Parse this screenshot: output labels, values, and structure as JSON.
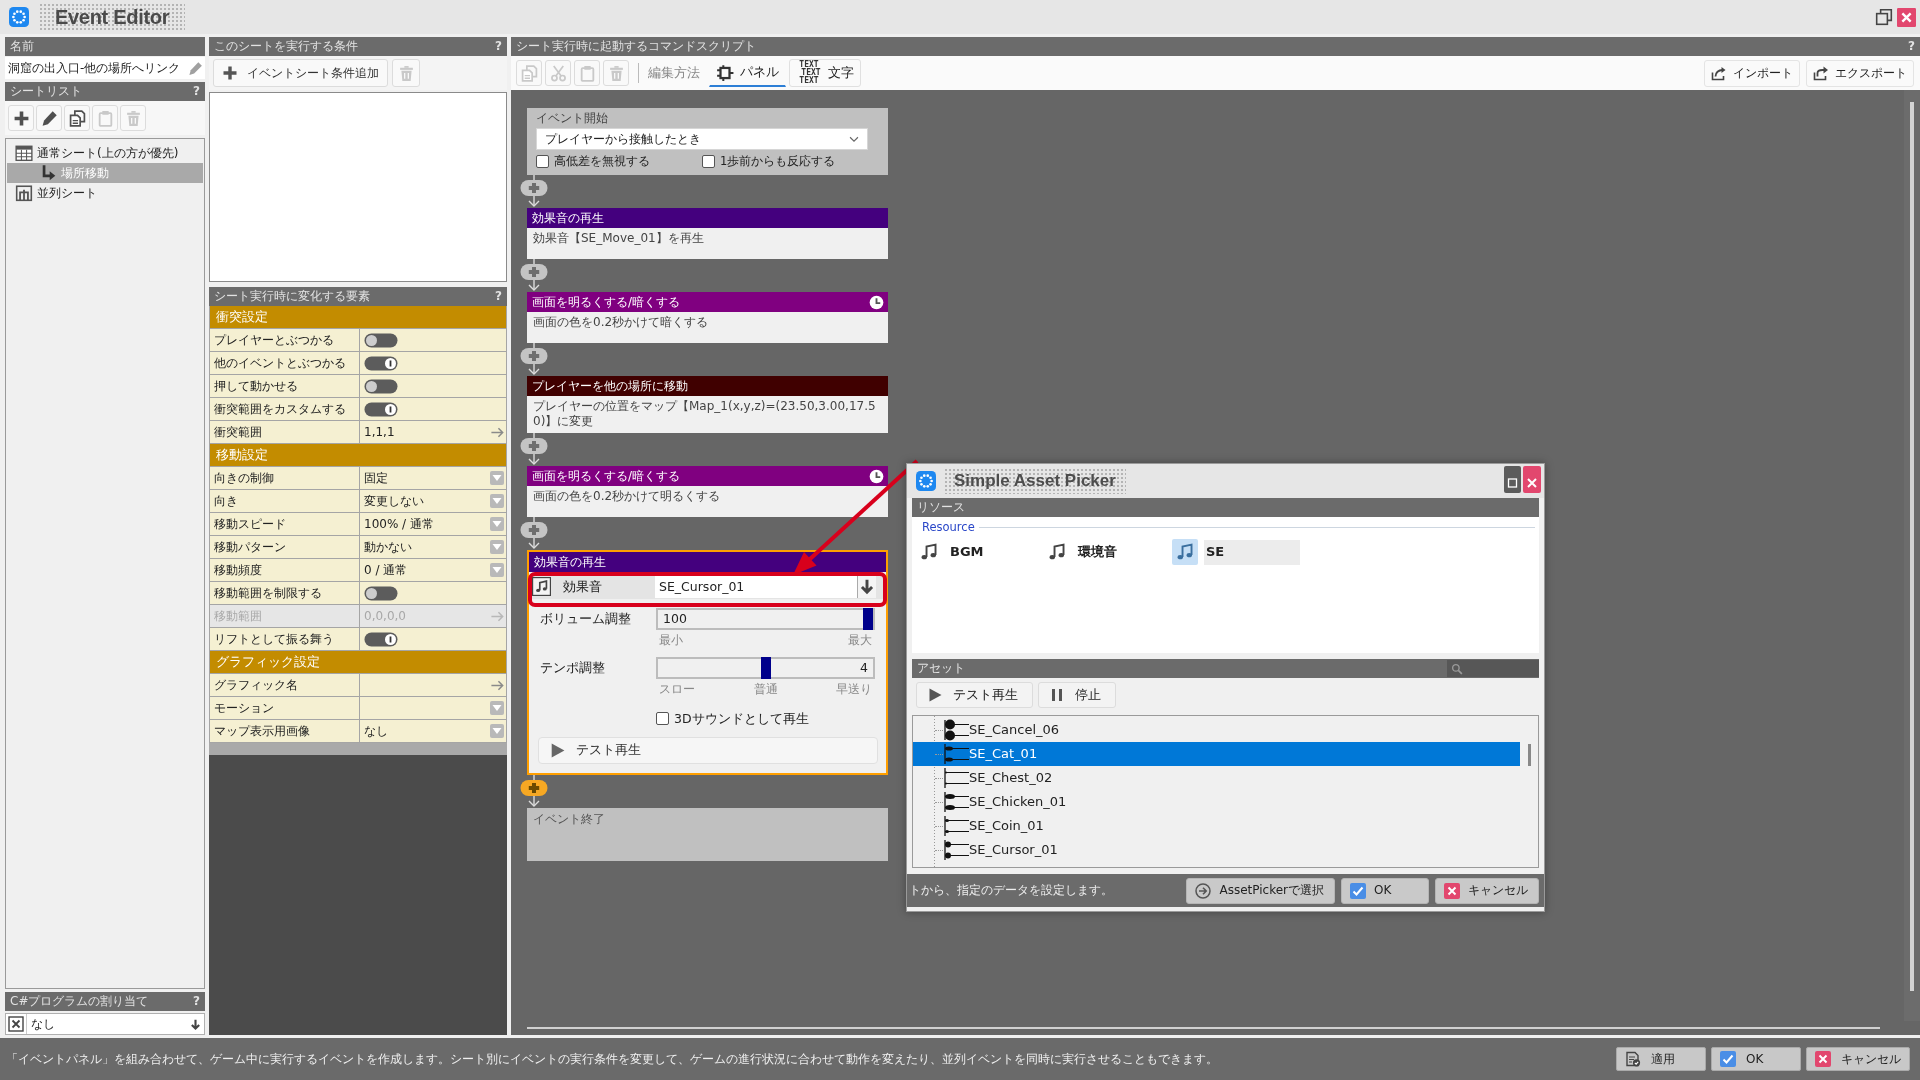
{
  "window": {
    "title": "Event Editor"
  },
  "name_panel": {
    "header": "名前",
    "value": "洞窟の出入口-他の場所へリンク"
  },
  "sheet_list": {
    "header": "シートリスト",
    "help": "?",
    "tools": [
      {
        "kind": "add",
        "disabled": false
      },
      {
        "kind": "edit",
        "disabled": false
      },
      {
        "kind": "copy",
        "disabled": false
      },
      {
        "kind": "paste",
        "disabled": true
      },
      {
        "kind": "delete",
        "disabled": true
      }
    ],
    "tree": [
      {
        "label": "通常シート(上の方が優先)",
        "kind": "normal",
        "selected": false,
        "children": [
          {
            "label": "場所移動",
            "kind": "item",
            "selected": true
          }
        ]
      },
      {
        "label": "並列シート",
        "kind": "parallel",
        "selected": false
      }
    ]
  },
  "csharp": {
    "header": "C#プログラムの割り当て",
    "help": "?",
    "value": "なし"
  },
  "conditions": {
    "header": "このシートを実行する条件",
    "help": "?",
    "add_button": "イベントシート条件追加",
    "delete_button": {
      "disabled": true
    }
  },
  "properties": {
    "header": "シート実行時に変化する要素",
    "help": "?",
    "groups": [
      {
        "title": "衝突設定",
        "rows": [
          {
            "label": "プレイヤーとぶつかる",
            "kind": "toggle",
            "on": false,
            "disabled": false
          },
          {
            "label": "他のイベントとぶつかる",
            "kind": "toggle",
            "on": true,
            "disabled": false
          },
          {
            "label": "押して動かせる",
            "kind": "toggle",
            "on": false,
            "disabled": false
          },
          {
            "label": "衝突範囲をカスタムする",
            "kind": "toggle",
            "on": true,
            "disabled": false
          },
          {
            "label": "衝突範囲",
            "kind": "link",
            "value": "1,1,1",
            "disabled": false
          }
        ]
      },
      {
        "title": "移動設定",
        "rows": [
          {
            "label": "向きの制御",
            "kind": "select",
            "value": "固定",
            "disabled": false
          },
          {
            "label": "向き",
            "kind": "select",
            "value": "変更しない",
            "disabled": false
          },
          {
            "label": "移動スピード",
            "kind": "select",
            "value": "100% / 通常",
            "disabled": false
          },
          {
            "label": "移動パターン",
            "kind": "select",
            "value": "動かない",
            "disabled": false
          },
          {
            "label": "移動頻度",
            "kind": "select",
            "value": "0 / 通常",
            "disabled": false
          },
          {
            "label": "移動範囲を制限する",
            "kind": "toggle",
            "on": false,
            "disabled": false
          },
          {
            "label": "移動範囲",
            "kind": "link",
            "value": "0,0,0,0",
            "disabled": true
          },
          {
            "label": "リフトとして振る舞う",
            "kind": "toggle",
            "on": true,
            "disabled": false
          }
        ]
      },
      {
        "title": "グラフィック設定",
        "rows": [
          {
            "label": "グラフィック名",
            "kind": "link",
            "disabled": false
          },
          {
            "label": "モーション",
            "kind": "select",
            "disabled": false
          },
          {
            "label": "マップ表示用画像",
            "kind": "select",
            "value": "なし",
            "disabled": false
          }
        ]
      }
    ]
  },
  "script": {
    "header": "シート実行時に起動するコマンドスクリプト",
    "help": "?",
    "tools": [
      {
        "kind": "copy",
        "disabled": true
      },
      {
        "kind": "cut",
        "disabled": true
      },
      {
        "kind": "paste",
        "disabled": true
      },
      {
        "kind": "delete",
        "disabled": true
      }
    ],
    "mode_label": "編集方法",
    "tabs": [
      {
        "label": "パネル",
        "kind": "panel",
        "selected": true
      },
      {
        "label": "文字",
        "kind": "text",
        "selected": false,
        "icon_text": [
          "TEXT",
          "TEXT",
          "TEXT"
        ]
      }
    ],
    "actions": [
      {
        "label": "インポート",
        "kind": "import"
      },
      {
        "label": "エクスポート",
        "kind": "export"
      }
    ],
    "commands": [
      {
        "kind": "start",
        "title": "イベント開始",
        "trigger": "プレイヤーから接触したとき",
        "options": [
          {
            "label": "高低差を無視する",
            "checked": false
          },
          {
            "label": "1歩前からも反応する",
            "checked": false
          }
        ],
        "selected": false
      },
      {
        "kind": "command",
        "title": "効果音の再生",
        "color": "#44007e",
        "body": "効果音【SE_Move_01】を再生",
        "timed": false,
        "selected": false
      },
      {
        "kind": "command",
        "title": "画面を明るくする/暗くする",
        "color": "#800080",
        "body": "画面の色を0.2秒かけて暗くする",
        "timed": true,
        "selected": false
      },
      {
        "kind": "command",
        "title": "プレイヤーを他の場所に移動",
        "color": "#400000",
        "body": "プレイヤーの位置をマップ【Map_1(x,y,z)=(23.50,3.00,17.50)】に変更",
        "timed": false,
        "selected": false
      },
      {
        "kind": "command",
        "title": "画面を明るくする/暗くする",
        "color": "#800080",
        "body": "画面の色を0.2秒かけて明るくする",
        "timed": true,
        "selected": false
      },
      {
        "kind": "sound_editor",
        "title": "効果音の再生",
        "color": "#44007e",
        "timed": false,
        "selected": true,
        "sound": {
          "label": "効果音",
          "value": "SE_Cursor_01",
          "callout": true
        },
        "volume": {
          "label": "ボリューム調整",
          "value": "100",
          "level": 1,
          "marks": [
            "最小",
            "最大"
          ]
        },
        "tempo": {
          "label": "テンポ調整",
          "value": "4",
          "level": 0.5,
          "marks": [
            "スロー",
            "普通",
            "早送り"
          ]
        },
        "spatial": {
          "label": "3Dサウンドとして再生",
          "checked": false
        },
        "test_button": "テスト再生"
      },
      {
        "kind": "end",
        "title": "イベント終了",
        "selected": false
      }
    ]
  },
  "asset_picker": {
    "title": "Simple Asset Picker",
    "resource_header": "リソース",
    "resource_group": "Resource",
    "resources": [
      {
        "label": "BGM",
        "selected": false
      },
      {
        "label": "環境音",
        "selected": false
      },
      {
        "label": "SE",
        "selected": true
      }
    ],
    "asset_header": "アセット",
    "buttons": [
      {
        "label": "テスト再生",
        "kind": "play"
      },
      {
        "label": "停止",
        "kind": "stop"
      }
    ],
    "assets": [
      {
        "label": "SE_Cancel_06",
        "selected": false
      },
      {
        "label": "SE_Cat_01",
        "selected": true
      },
      {
        "label": "SE_Chest_02",
        "selected": false
      },
      {
        "label": "SE_Chicken_01",
        "selected": false
      },
      {
        "label": "SE_Coin_01",
        "selected": false
      },
      {
        "label": "SE_Cursor_01",
        "selected": false
      }
    ],
    "hint": "トから、指定のデータを設定します。",
    "footer_buttons": [
      {
        "label": "AssetPickerで選択",
        "kind": "pick"
      },
      {
        "label": "OK",
        "kind": "ok"
      },
      {
        "label": "キャンセル",
        "kind": "cancel"
      }
    ]
  },
  "status_bar": {
    "message": "「イベントパネル」を組み合わせて、ゲーム中に実行するイベントを作成します。シート別にイベントの実行条件を変更して、ゲームの進行状況に合わせて動作を変えたり、並列イベントを同時に実行させることもできます。",
    "buttons": [
      {
        "label": "適用",
        "kind": "apply"
      },
      {
        "label": "OK",
        "kind": "ok"
      },
      {
        "label": "キャンセル",
        "kind": "cancel"
      }
    ]
  }
}
